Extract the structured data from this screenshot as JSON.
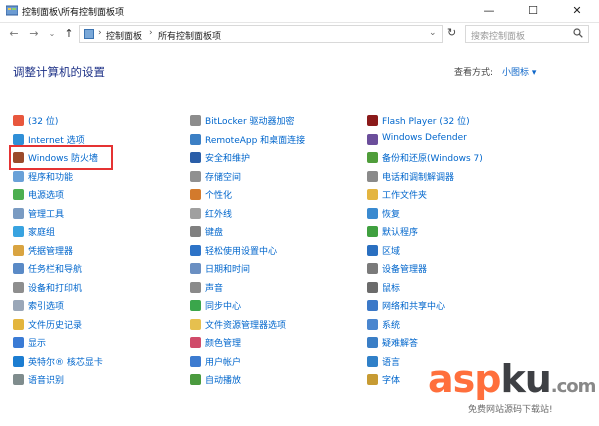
{
  "window": {
    "title": "控制面板\\所有控制面板项",
    "controls": {
      "minimize": "—",
      "maximize": "☐",
      "close": "✕"
    }
  },
  "address": {
    "crumbs": [
      "控制面板",
      "所有控制面板项"
    ],
    "search_placeholder": "搜索控制面板"
  },
  "header": {
    "title": "调整计算机的设置",
    "view_by_label": "查看方式:",
    "view_by_value": "小图标 ▾"
  },
  "columns": [
    [
      {
        "label": "(32 位)",
        "icon": "java-icon",
        "color": "#e8573d"
      },
      {
        "label": "Internet 选项",
        "icon": "globe-icon",
        "color": "#2f8fd7"
      },
      {
        "label": "Windows 防火墙",
        "icon": "firewall-icon",
        "color": "#9b4a2b"
      },
      {
        "label": "程序和功能",
        "icon": "programs-icon",
        "color": "#6aa1d8"
      },
      {
        "label": "电源选项",
        "icon": "power-icon",
        "color": "#4caf50"
      },
      {
        "label": "管理工具",
        "icon": "admin-tools-icon",
        "color": "#7a9bc2"
      },
      {
        "label": "家庭组",
        "icon": "homegroup-icon",
        "color": "#38a3e0"
      },
      {
        "label": "凭据管理器",
        "icon": "credential-icon",
        "color": "#d9a441"
      },
      {
        "label": "任务栏和导航",
        "icon": "taskbar-icon",
        "color": "#5a8ac6"
      },
      {
        "label": "设备和打印机",
        "icon": "printer-icon",
        "color": "#8e8e8e"
      },
      {
        "label": "索引选项",
        "icon": "index-icon",
        "color": "#9aa7b8"
      },
      {
        "label": "文件历史记录",
        "icon": "file-history-icon",
        "color": "#e3b53d"
      },
      {
        "label": "显示",
        "icon": "display-icon",
        "color": "#3a7bd5"
      },
      {
        "label": "英特尔® 核芯显卡",
        "icon": "intel-icon",
        "color": "#1c7dd1"
      },
      {
        "label": "语音识别",
        "icon": "microphone-icon",
        "color": "#7f8c8d"
      }
    ],
    [
      {
        "label": "BitLocker 驱动器加密",
        "icon": "bitlocker-icon",
        "color": "#8c8c8c"
      },
      {
        "label": "RemoteApp 和桌面连接",
        "icon": "remoteapp-icon",
        "color": "#3b7fc4"
      },
      {
        "label": "安全和维护",
        "icon": "flag-icon",
        "color": "#2a5ea8"
      },
      {
        "label": "存储空间",
        "icon": "storage-icon",
        "color": "#909090"
      },
      {
        "label": "个性化",
        "icon": "personalize-icon",
        "color": "#d37a2c"
      },
      {
        "label": "红外线",
        "icon": "infrared-icon",
        "color": "#a0a0a0"
      },
      {
        "label": "键盘",
        "icon": "keyboard-icon",
        "color": "#808080"
      },
      {
        "label": "轻松使用设置中心",
        "icon": "ease-of-access-icon",
        "color": "#2d73c7"
      },
      {
        "label": "日期和时间",
        "icon": "clock-icon",
        "color": "#6a8fc2"
      },
      {
        "label": "声音",
        "icon": "sound-icon",
        "color": "#8a8a8a"
      },
      {
        "label": "同步中心",
        "icon": "sync-icon",
        "color": "#3aa64b"
      },
      {
        "label": "文件资源管理器选项",
        "icon": "folder-options-icon",
        "color": "#e6c04f"
      },
      {
        "label": "颜色管理",
        "icon": "color-icon",
        "color": "#d04b6a"
      },
      {
        "label": "用户帐户",
        "icon": "user-icon",
        "color": "#3c7bd0"
      },
      {
        "label": "自动播放",
        "icon": "autoplay-icon",
        "color": "#4a9a3e"
      }
    ],
    [
      {
        "label": "Flash Player (32 位)",
        "icon": "flash-icon",
        "color": "#8b1a1a"
      },
      {
        "label": "Windows Defender",
        "icon": "defender-icon",
        "color": "#6b4e9b"
      },
      {
        "label": "备份和还原(Windows 7)",
        "icon": "backup-icon",
        "color": "#4f9d3a"
      },
      {
        "label": "电话和调制解调器",
        "icon": "phone-icon",
        "color": "#8a8a8a"
      },
      {
        "label": "工作文件夹",
        "icon": "work-folders-icon",
        "color": "#e4b540"
      },
      {
        "label": "恢复",
        "icon": "recovery-icon",
        "color": "#3a8ad0"
      },
      {
        "label": "默认程序",
        "icon": "default-programs-icon",
        "color": "#3fa03f"
      },
      {
        "label": "区域",
        "icon": "region-icon",
        "color": "#2a6fc0"
      },
      {
        "label": "设备管理器",
        "icon": "device-manager-icon",
        "color": "#7a7a7a"
      },
      {
        "label": "鼠标",
        "icon": "mouse-icon",
        "color": "#6b6b6b"
      },
      {
        "label": "网络和共享中心",
        "icon": "network-icon",
        "color": "#3c79c8"
      },
      {
        "label": "系统",
        "icon": "system-icon",
        "color": "#4a86cf"
      },
      {
        "label": "疑难解答",
        "icon": "troubleshoot-icon",
        "color": "#3a7ec6"
      },
      {
        "label": "语言",
        "icon": "language-icon",
        "color": "#3080c8"
      },
      {
        "label": "字体",
        "icon": "font-icon",
        "color": "#c79b33"
      }
    ]
  ],
  "watermark": {
    "part1": "asp",
    "part2": "ku",
    "part3": ".com",
    "subtitle": "免费网站源码下载站!"
  }
}
